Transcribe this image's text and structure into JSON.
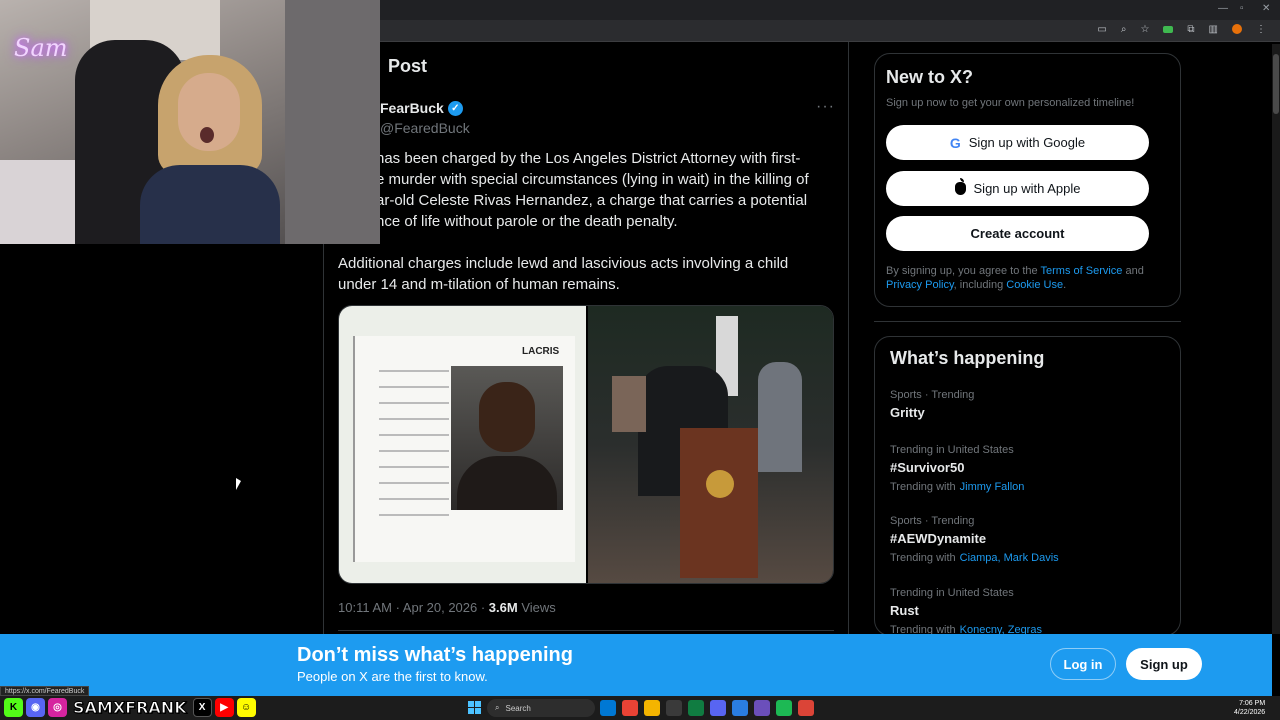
{
  "webcam": {
    "logo_text": "Sam"
  },
  "post": {
    "header": "Post",
    "author_name": "FearBuck",
    "author_handle": "@FearedBuck",
    "paragraph1": "has been charged by the Los Angeles District Attorney with first-\ne murder with special circumstances (lying in wait) in the killing of\nar-old Celeste Rivas Hernandez, a charge that carries a potential\nnce of life without parole or the death penalty.",
    "paragraph2": "Additional charges include lewd and lascivious acts involving a child\nunder 14 and m-tilation of human remains.",
    "mugshot_label": "LACRIS",
    "time": "10:11 AM · Apr 20, 2026 · ",
    "views_count": "3.6M",
    "views_label": " Views"
  },
  "signup": {
    "title": "New to X?",
    "subtitle": "Sign up now to get your own personalized timeline!",
    "google_label": "Sign up with Google",
    "apple_label": "Sign up with Apple",
    "create_label": "Create account",
    "terms_prefix": "By signing up, you agree to the ",
    "terms_link": "Terms of Service",
    "terms_and": " and",
    "privacy_link": "Privacy Policy",
    "terms_including": ", including ",
    "cookie_link": "Cookie Use",
    "terms_end": "."
  },
  "trends": {
    "title": "What’s happening",
    "items": [
      {
        "context": "Sports · Trending",
        "name": "Gritty",
        "with_label": "",
        "with": ""
      },
      {
        "context": "Trending in United States",
        "name": "#Survivor50",
        "with_label": "Trending with",
        "with": "Jimmy Fallon"
      },
      {
        "context": "Sports · Trending",
        "name": "#AEWDynamite",
        "with_label": "Trending with",
        "with": "Ciampa, Mark Davis"
      },
      {
        "context": "Trending in United States",
        "name": "Rust",
        "with_label": "Trending with",
        "with": "Konecny, Zegras"
      }
    ]
  },
  "banner": {
    "title": "Don’t miss what’s happening",
    "subtitle": "People on X are the first to know.",
    "login_label": "Log in",
    "signup_label": "Sign up"
  },
  "status_url": "https://x.com/FearedBuck",
  "taskbar": {
    "handle": "SAMXFRANK",
    "search_label": "Search",
    "time": "7:06 PM",
    "date": "4/22/2026"
  },
  "colors": {
    "accent": "#1d9bf0",
    "background": "#000000",
    "text": "#e7e9ea",
    "muted": "#71767b"
  }
}
